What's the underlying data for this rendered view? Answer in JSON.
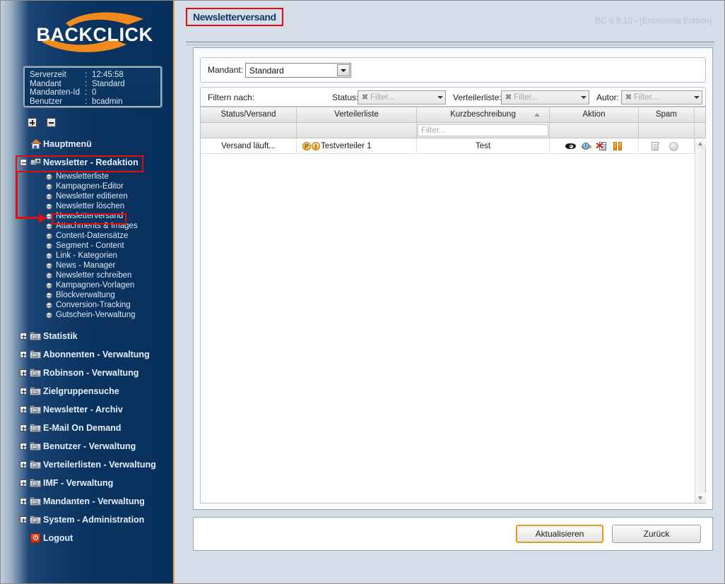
{
  "app": {
    "logo_text": "BACKCLICK"
  },
  "sidebar": {
    "info": [
      {
        "key": "Serverzeit",
        "sep": ":",
        "value": "12:45:58"
      },
      {
        "key": "Mandant",
        "sep": ":",
        "value": "Standard"
      },
      {
        "key": "Mandanten-Id",
        "sep": ":",
        "value": "0"
      },
      {
        "key": "Benutzer",
        "sep": ":",
        "value": "bcadmin"
      }
    ],
    "zoom_buttons": [
      {
        "name": "expand-all-button",
        "glyph": "+"
      },
      {
        "name": "collapse-all-button",
        "glyph": "-"
      }
    ],
    "items": [
      {
        "label": "Hauptmenü",
        "icon": "house-icon",
        "state": "leaf"
      },
      {
        "label": "Newsletter - Redaktion",
        "icon": "camera-icon",
        "state": "expanded",
        "highlighted": true
      },
      {
        "label": "Statistik",
        "icon": "folder-icon",
        "state": "collapsed"
      },
      {
        "label": "Abonnenten - Verwaltung",
        "icon": "folder-icon",
        "state": "collapsed"
      },
      {
        "label": "Robinson - Verwaltung",
        "icon": "folder-icon",
        "state": "collapsed"
      },
      {
        "label": "Zielgruppensuche",
        "icon": "folder-icon",
        "state": "collapsed"
      },
      {
        "label": "Newsletter - Archiv",
        "icon": "folder-icon",
        "state": "collapsed"
      },
      {
        "label": "E-Mail On Demand",
        "icon": "folder-icon",
        "state": "collapsed"
      },
      {
        "label": "Benutzer - Verwaltung",
        "icon": "folder-icon",
        "state": "collapsed"
      },
      {
        "label": "Verteilerlisten - Verwaltung",
        "icon": "folder-icon",
        "state": "collapsed"
      },
      {
        "label": "IMF - Verwaltung",
        "icon": "folder-icon",
        "state": "collapsed"
      },
      {
        "label": "Mandanten - Verwaltung",
        "icon": "folder-icon",
        "state": "collapsed"
      },
      {
        "label": "System - Administration",
        "icon": "folder-icon",
        "state": "collapsed"
      },
      {
        "label": "Logout",
        "icon": "logout-icon",
        "state": "leaf"
      }
    ],
    "subitems": [
      {
        "label": "Newsletterliste"
      },
      {
        "label": "Kampagnen-Editor"
      },
      {
        "label": "Newsletter editieren"
      },
      {
        "label": "Newsletter löschen"
      },
      {
        "label": "Newsletterversand",
        "selected": true
      },
      {
        "label": "Attachments & Images"
      },
      {
        "label": "Content-Datensätze"
      },
      {
        "label": "Segment - Content"
      },
      {
        "label": "Link - Kategorien"
      },
      {
        "label": "News - Manager"
      },
      {
        "label": "Newsletter schreiben"
      },
      {
        "label": "Kampagnen-Vorlagen"
      },
      {
        "label": "Blockverwaltung"
      },
      {
        "label": "Conversion-Tracking"
      },
      {
        "label": "Gutschein-Verwaltung"
      }
    ]
  },
  "header": {
    "title": "Newsletterversand",
    "version": "BC 5.9.10 - [Enterprise Edition]"
  },
  "mandant": {
    "label": "Mandant:",
    "value": "Standard"
  },
  "filters": {
    "label": "Filtern nach:",
    "fields": [
      {
        "label": "Status:",
        "placeholder": "Filter...",
        "value": "",
        "clear_glyph": "✖"
      },
      {
        "label": "Verteilerliste:",
        "placeholder": "Filter...",
        "value": "",
        "clear_glyph": "✖"
      },
      {
        "label": "Autor:",
        "placeholder": "Filter...",
        "value": "",
        "clear_glyph": "✖"
      }
    ]
  },
  "grid": {
    "columns": [
      {
        "label": "Status/Versand",
        "sorted": ""
      },
      {
        "label": "Verteilerliste",
        "sorted": ""
      },
      {
        "label": "Kurzbeschreibung",
        "sorted": "asc"
      },
      {
        "label": "Aktion",
        "sorted": ""
      },
      {
        "label": "Spam",
        "sorted": ""
      }
    ],
    "filter_row": {
      "kurzbeschreibung_placeholder": "Filter..."
    },
    "rows": [
      {
        "status": "Versand läuft...",
        "verteilerliste": "Testverteiler 1",
        "verteilerliste_badges": [
          "P",
          "i"
        ],
        "kurzbeschreibung": "Test",
        "aktion_icons": [
          "eye-icon",
          "clock-arrow-icon",
          "document-cancel-icon",
          "pause-icon"
        ],
        "spam_icons": [
          "grey-document-icon",
          "grey-circle-icon"
        ]
      }
    ],
    "scrollbar": {
      "up_glyph": "▲",
      "down_glyph": "▼"
    }
  },
  "footer": {
    "buttons": [
      {
        "label": "Aktualisieren",
        "focused": true
      },
      {
        "label": "Zurück",
        "focused": false
      }
    ]
  },
  "colors": {
    "brand_orange": "#e8a33d",
    "sidebar_navy": "#0a335f",
    "page_bg": "#d5dde8",
    "annotation_red": "#e10e0e",
    "title_blue": "#123a6b"
  }
}
